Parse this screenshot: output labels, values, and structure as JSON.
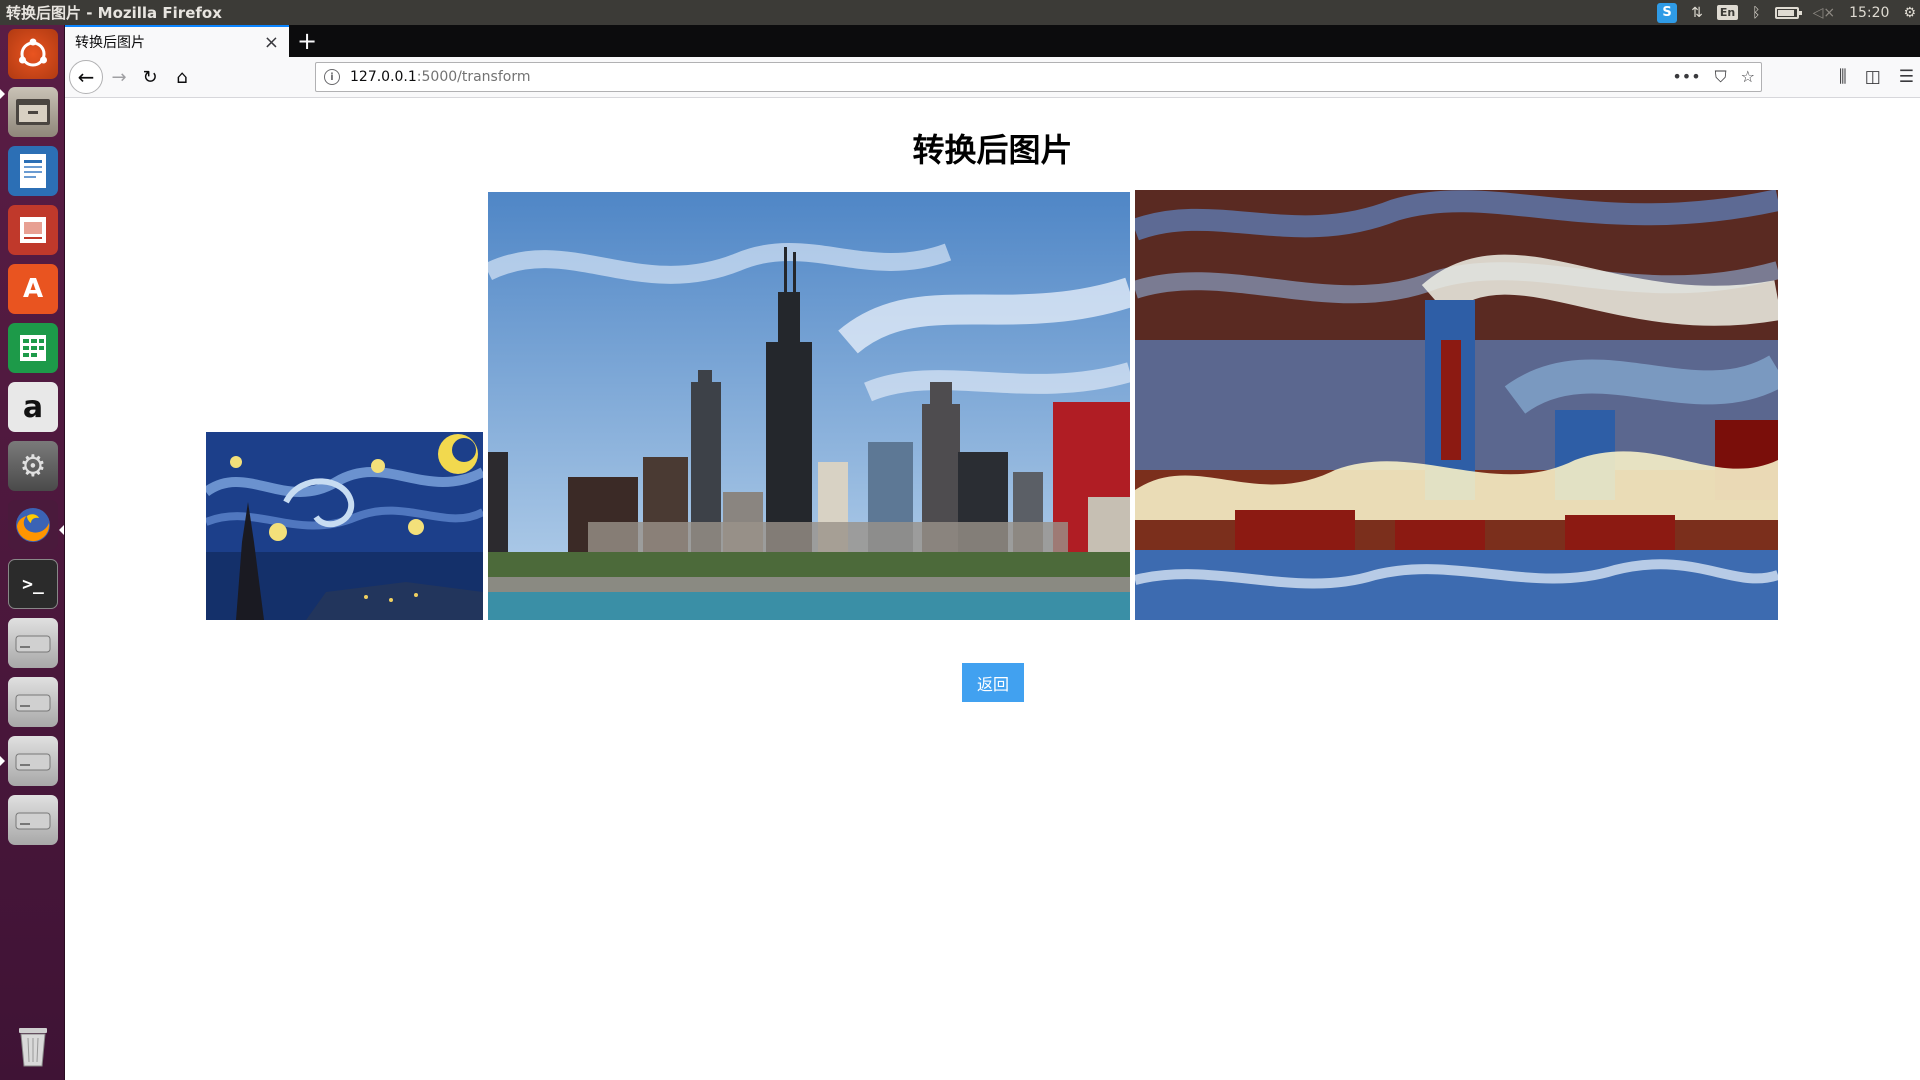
{
  "system": {
    "window_title": "转换后图片 - Mozilla Firefox",
    "clock": "15:20",
    "input_method": "En",
    "sogou_label": "S"
  },
  "browser": {
    "tab_title": "转换后图片",
    "url_host": "127.0.0.1",
    "url_path": ":5000/transform"
  },
  "page": {
    "title": "转换后图片",
    "back_button": "返回"
  },
  "images": [
    {
      "name": "style-image",
      "depicts": "Starry Night painting"
    },
    {
      "name": "content-image",
      "depicts": "Chicago skyline photo"
    },
    {
      "name": "stylized-result",
      "depicts": "stylized Chicago skyline"
    }
  ],
  "icons": {
    "launcher": [
      "ubuntu-dash-icon",
      "files-icon",
      "writer-icon",
      "impress-icon",
      "software-center-icon",
      "calc-icon",
      "amazon-icon",
      "system-settings-icon",
      "firefox-icon",
      "terminal-icon",
      "drive-icon",
      "drive-icon",
      "drive-icon",
      "drive-icon",
      "trash-icon"
    ]
  },
  "colors": {
    "accent": "#41a1f0",
    "tab_highlight": "#0a84ff",
    "launcher": "#5a1d45",
    "panel": "#3c3b37"
  }
}
